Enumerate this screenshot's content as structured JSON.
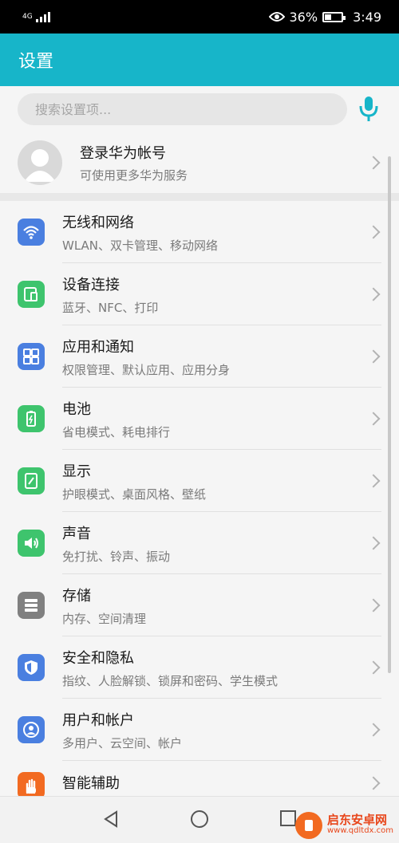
{
  "status_bar": {
    "signal_label": "4G",
    "battery_percent": "36%",
    "time": "3:49",
    "icons": [
      "signal-icon",
      "eye-icon",
      "battery-icon"
    ]
  },
  "app_bar": {
    "title": "设置"
  },
  "search": {
    "placeholder": "搜索设置项..."
  },
  "account": {
    "title": "登录华为帐号",
    "subtitle": "可使用更多华为服务"
  },
  "settings": [
    {
      "icon": "wifi-icon",
      "color": "#4a7fe0",
      "title": "无线和网络",
      "subtitle": "WLAN、双卡管理、移动网络"
    },
    {
      "icon": "device-connect-icon",
      "color": "#3ec46d",
      "title": "设备连接",
      "subtitle": "蓝牙、NFC、打印"
    },
    {
      "icon": "apps-grid-icon",
      "color": "#4a7fe0",
      "title": "应用和通知",
      "subtitle": "权限管理、默认应用、应用分身"
    },
    {
      "icon": "battery-charge-icon",
      "color": "#3ec46d",
      "title": "电池",
      "subtitle": "省电模式、耗电排行"
    },
    {
      "icon": "display-icon",
      "color": "#3ec46d",
      "title": "显示",
      "subtitle": "护眼模式、桌面风格、壁纸"
    },
    {
      "icon": "sound-icon",
      "color": "#3ec46d",
      "title": "声音",
      "subtitle": "免打扰、铃声、振动"
    },
    {
      "icon": "storage-icon",
      "color": "#808080",
      "title": "存储",
      "subtitle": "内存、空间清理"
    },
    {
      "icon": "shield-icon",
      "color": "#4a7fe0",
      "title": "安全和隐私",
      "subtitle": "指纹、人脸解锁、锁屏和密码、学生模式"
    },
    {
      "icon": "user-icon",
      "color": "#4a7fe0",
      "title": "用户和帐户",
      "subtitle": "多用户、云空间、帐户"
    },
    {
      "icon": "hand-icon",
      "color": "#f26a21",
      "title": "智能辅助",
      "subtitle": ""
    }
  ],
  "watermark": {
    "title": "启东安卓网",
    "url": "www.qdltdx.com"
  }
}
